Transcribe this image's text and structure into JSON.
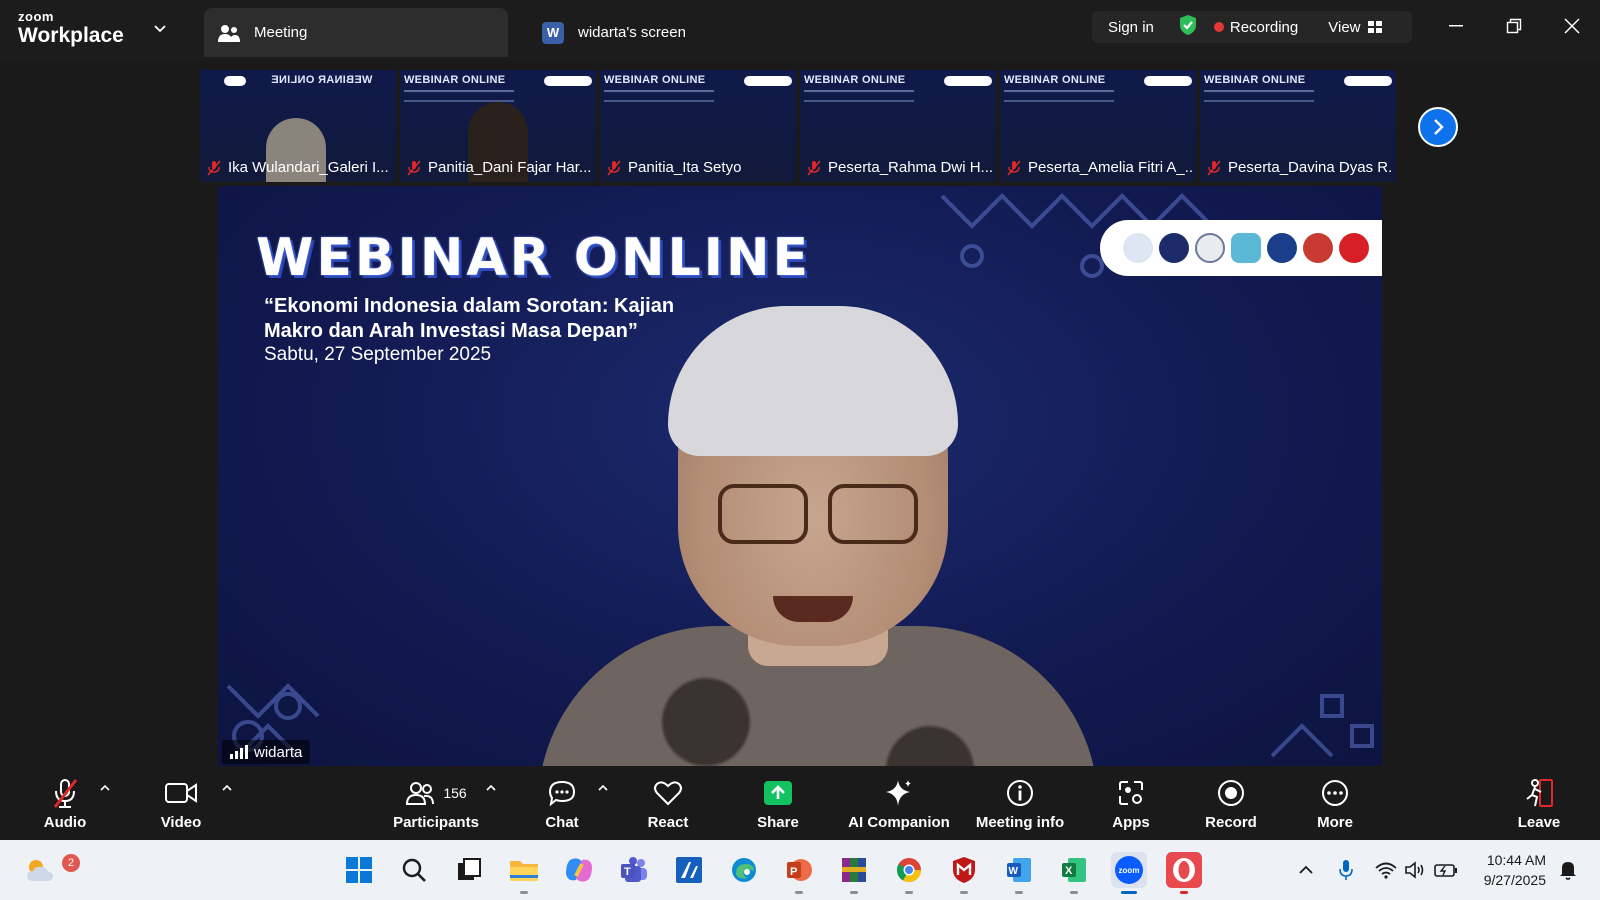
{
  "app": {
    "brand_small": "zoom",
    "brand_large": "Workplace"
  },
  "tabs": [
    {
      "label": "Meeting",
      "icon": "people-icon"
    },
    {
      "label": "widarta's screen",
      "icon": "word-doc-icon",
      "badge": "W"
    }
  ],
  "header": {
    "sign_in": "Sign in",
    "recording": "Recording",
    "view": "View",
    "colors": {
      "recording_dot": "#e53935",
      "shield": "#2ebd59",
      "accent": "#0e72ed"
    }
  },
  "thumbnails": {
    "banner_text": "WEBINAR ONLINE",
    "items": [
      {
        "name": "Ika Wulandari_Galeri I...",
        "muted": true
      },
      {
        "name": "Panitia_Dani Fajar Har...",
        "muted": true
      },
      {
        "name": "Panitia_Ita Setyo",
        "muted": true
      },
      {
        "name": "Peserta_Rahma Dwi H...",
        "muted": true
      },
      {
        "name": "Peserta_Amelia Fitri A_...",
        "muted": true
      },
      {
        "name": "Peserta_Davina Dyas R...",
        "muted": true
      }
    ]
  },
  "stage": {
    "title": "WEBINAR ONLINE",
    "subtitle_line1": "“Ekonomi Indonesia dalam Sorotan: Kajian",
    "subtitle_line2": "Makro dan Arah Investasi Masa Depan”",
    "date": "Sabtu, 27 September 2025",
    "speaker_name": "widarta"
  },
  "toolbar": {
    "audio": "Audio",
    "video": "Video",
    "participants": "Participants",
    "participants_count": "156",
    "chat": "Chat",
    "react": "React",
    "share": "Share",
    "ai_companion": "AI Companion",
    "meeting_info": "Meeting info",
    "apps": "Apps",
    "record": "Record",
    "more": "More",
    "leave": "Leave"
  },
  "taskbar": {
    "weather_badge": "2",
    "time": "10:44 AM",
    "date": "9/27/2025",
    "apps": [
      "start-icon",
      "search-icon",
      "task-view-icon",
      "file-explorer-icon",
      "copilot-icon",
      "teams-icon",
      "app-icon",
      "edge-icon",
      "powerpoint-icon",
      "winrar-icon",
      "chrome-icon",
      "mcafee-icon",
      "word-icon",
      "excel-icon",
      "zoom-icon",
      "opera-icon"
    ]
  }
}
